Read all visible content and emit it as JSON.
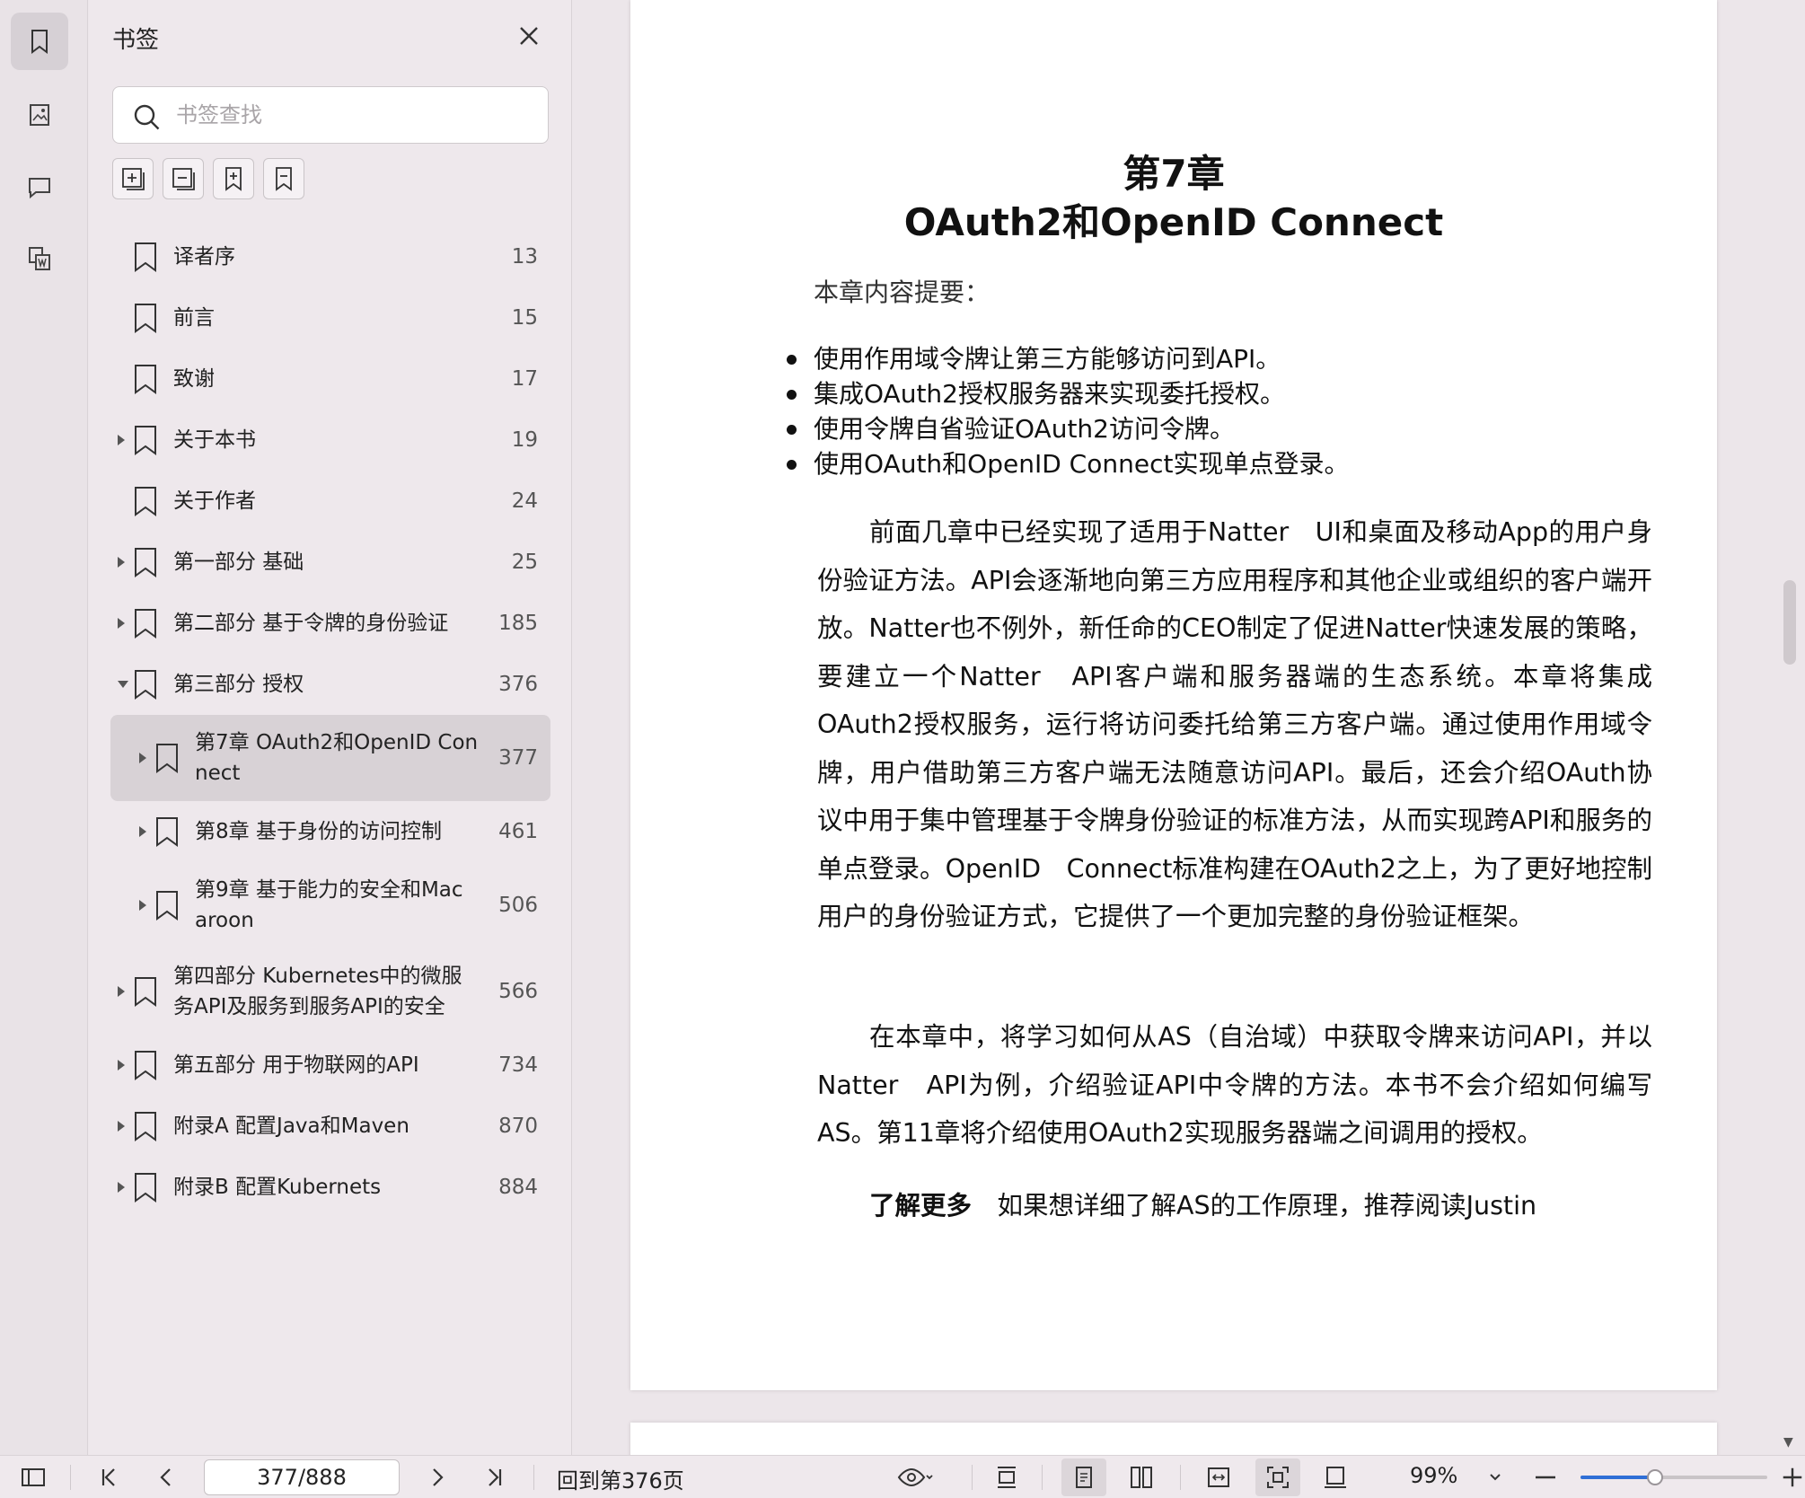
{
  "panel": {
    "title": "书签",
    "search_placeholder": "书签查找"
  },
  "bookmarks": [
    {
      "label": "译者序",
      "page": "13",
      "expander": "none",
      "level": 0
    },
    {
      "label": "前言",
      "page": "15",
      "expander": "none",
      "level": 0
    },
    {
      "label": "致谢",
      "page": "17",
      "expander": "none",
      "level": 0
    },
    {
      "label": "关于本书",
      "page": "19",
      "expander": "collapsed",
      "level": 0
    },
    {
      "label": "关于作者",
      "page": "24",
      "expander": "none",
      "level": 0
    },
    {
      "label": "第一部分 基础",
      "page": "25",
      "expander": "collapsed",
      "level": 0
    },
    {
      "label": "第二部分 基于令牌的身份验证",
      "page": "185",
      "expander": "collapsed",
      "level": 0
    },
    {
      "label": "第三部分 授权",
      "page": "376",
      "expander": "expanded",
      "level": 0
    },
    {
      "label": "第7章 OAuth2和OpenID Con\nnect",
      "page": "377",
      "expander": "collapsed",
      "level": 1,
      "selected": true
    },
    {
      "label": "第8章 基于身份的访问控制",
      "page": "461",
      "expander": "collapsed",
      "level": 1
    },
    {
      "label": "第9章 基于能力的安全和Mac\naroon",
      "page": "506",
      "expander": "collapsed",
      "level": 1
    },
    {
      "label": "第四部分 Kubernetes中的微服\n务API及服务到服务API的安全",
      "page": "566",
      "expander": "collapsed",
      "level": 0
    },
    {
      "label": "第五部分 用于物联网的API",
      "page": "734",
      "expander": "collapsed",
      "level": 0
    },
    {
      "label": "附录A 配置Java和Maven",
      "page": "870",
      "expander": "collapsed",
      "level": 0
    },
    {
      "label": "附录B 配置Kubernets",
      "page": "884",
      "expander": "collapsed",
      "level": 0
    }
  ],
  "document": {
    "chapter_number": "第7章",
    "chapter_title": "OAuth2和OpenID Connect",
    "summary_label": "本章内容提要：",
    "bullets": [
      "使用作用域令牌让第三方能够访问到API。",
      "集成OAuth2授权服务器来实现委托授权。",
      "使用令牌自省验证OAuth2访问令牌。",
      "使用OAuth和OpenID Connect实现单点登录。"
    ],
    "paragraph1": "前面几章中已经实现了适用于Natter　UI和桌面及移动App的用户身份验证方法。API会逐渐地向第三方应用程序和其他企业或组织的客户端开放。Natter也不例外，新任命的CEO制定了促进Natter快速发展的策略，要建立一个Natter　API客户端和服务器端的生态系统。本章将集成OAuth2授权服务，运行将访问委托给第三方客户端。通过使用作用域令牌，用户借助第三方客户端无法随意访问API。最后，还会介绍OAuth协议中用于集中管理基于令牌身份验证的标准方法，从而实现跨API和服务的单点登录。OpenID　Connect标准构建在OAuth2之上，为了更好地控制用户的身份验证方式，它提供了一个更加完整的身份验证框架。",
    "paragraph2": "在本章中，将学习如何从AS（自治域）中获取令牌来访问API，并以Natter　API为例，介绍验证API中令牌的方法。本书不会介绍如何编写AS。第11章将介绍使用OAuth2实现服务器端之间调用的授权。",
    "para3_bold": "了解更多",
    "para3_text": "　如果想详细了解AS的工作原理，推荐阅读Justin"
  },
  "statusbar": {
    "page_value": "377/888",
    "back_to_page": "回到第376页",
    "zoom": "99%",
    "zoom_fraction": 0.4
  }
}
